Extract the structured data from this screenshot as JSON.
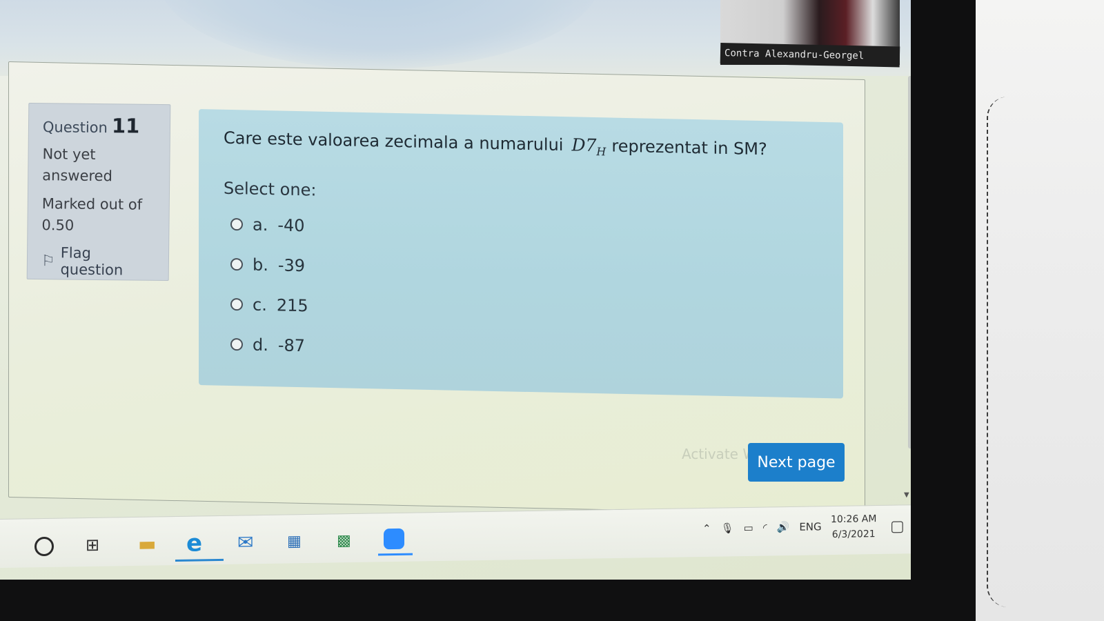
{
  "video_tile": {
    "participant_name": "Contra Alexandru-Georgel"
  },
  "question_info": {
    "label": "Question",
    "number": "11",
    "status": "Not yet answered",
    "marked_out_of_label": "Marked out of",
    "marked_out_of_value": "0.50",
    "flag_label": "Flag question"
  },
  "question": {
    "text_before": "Care este valoarea zecimala a numarului",
    "formula_main": "D7",
    "formula_sub": "H",
    "text_after": "reprezentat in SM?",
    "select_prompt": "Select one:",
    "answers": [
      {
        "letter": "a.",
        "value": "-40"
      },
      {
        "letter": "b.",
        "value": "-39"
      },
      {
        "letter": "c.",
        "value": "215"
      },
      {
        "letter": "d.",
        "value": "-87"
      }
    ]
  },
  "navigation": {
    "next_label": "Next page",
    "watermark": "Activate Windows"
  },
  "taskbar": {
    "tray_language": "ENG",
    "time": "10:26 AM",
    "date": "6/3/2021"
  },
  "colors": {
    "accent_button": "#1c7fcb",
    "question_bg": "#b8dbe4",
    "info_bg": "#cdd5dc"
  }
}
